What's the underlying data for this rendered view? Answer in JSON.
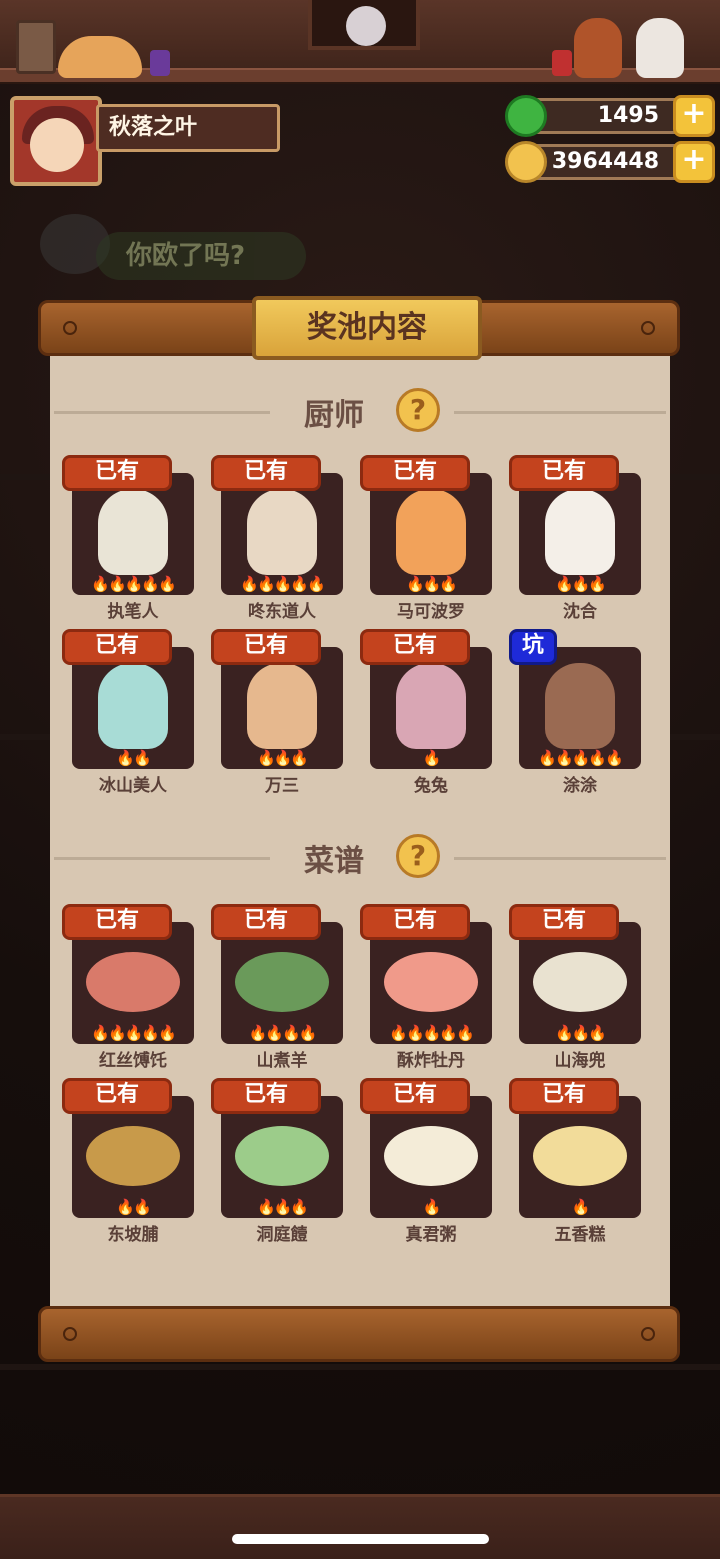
{
  "player": {
    "name": "秋落之叶"
  },
  "currencies": [
    {
      "icon": "jade-coin-icon",
      "value": "1495",
      "color": "#3fb441"
    },
    {
      "icon": "gold-coin-icon",
      "value": "3964448",
      "color": "#f2c24e"
    }
  ],
  "background": {
    "faded_title": "你欧了吗?"
  },
  "panel": {
    "title": "奖池内容",
    "sections": [
      {
        "label": "厨师",
        "items": [
          {
            "badge": "已有",
            "name": "执笔人",
            "stars": 5,
            "art": "#e9e4d6"
          },
          {
            "badge": "已有",
            "name": "咚东道人",
            "stars": 5,
            "art": "#e8d8c4"
          },
          {
            "badge": "已有",
            "name": "马可波罗",
            "stars": 3,
            "art": "#f2a25a"
          },
          {
            "badge": "已有",
            "name": "沈合",
            "stars": 3,
            "art": "#f4efe8"
          },
          {
            "badge": "已有",
            "name": "冰山美人",
            "stars": 2,
            "art": "#a8dcd6"
          },
          {
            "badge": "已有",
            "name": "万三",
            "stars": 3,
            "art": "#e6b88e"
          },
          {
            "badge": "已有",
            "name": "兔兔",
            "stars": 1,
            "art": "#d9a6b4"
          },
          {
            "badge": "坑",
            "name": "涂涂",
            "stars": 5,
            "art": "#9a6a52"
          }
        ]
      },
      {
        "label": "菜谱",
        "items": [
          {
            "badge": "已有",
            "name": "红丝馎饦",
            "stars": 5,
            "art": "#d97a6a"
          },
          {
            "badge": "已有",
            "name": "山煮羊",
            "stars": 4,
            "art": "#6a9a5a"
          },
          {
            "badge": "已有",
            "name": "酥炸牡丹",
            "stars": 5,
            "art": "#f09a8a"
          },
          {
            "badge": "已有",
            "name": "山海兜",
            "stars": 3,
            "art": "#e9e2d0"
          },
          {
            "badge": "已有",
            "name": "东坡脯",
            "stars": 2,
            "art": "#c89a4a"
          },
          {
            "badge": "已有",
            "name": "洞庭饐",
            "stars": 3,
            "art": "#9ccc8a"
          },
          {
            "badge": "已有",
            "name": "真君粥",
            "stars": 1,
            "art": "#f4ecd8"
          },
          {
            "badge": "已有",
            "name": "五香糕",
            "stars": 1,
            "art": "#f2dc9a"
          }
        ]
      }
    ]
  }
}
